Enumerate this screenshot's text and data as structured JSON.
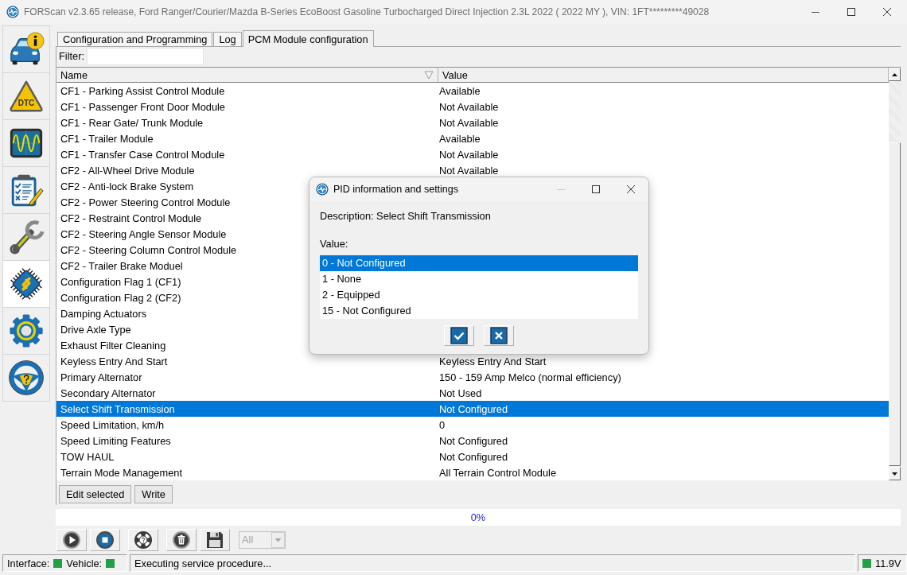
{
  "window": {
    "title": "FORScan v2.3.65 release, Ford Ranger/Courier/Mazda B-Series EcoBoost Gasoline Turbocharged Direct Injection 2.3L 2022 ( 2022 MY ), VIN: 1FT*********49028"
  },
  "sidebar": {
    "items": [
      {
        "kind": "vehicle",
        "selected": false
      },
      {
        "kind": "dtc",
        "label": "DTC",
        "selected": false
      },
      {
        "kind": "oscilloscope",
        "selected": false
      },
      {
        "kind": "checklist",
        "selected": false
      },
      {
        "kind": "service",
        "selected": false
      },
      {
        "kind": "modules",
        "selected": true
      },
      {
        "kind": "settings",
        "selected": false
      },
      {
        "kind": "help",
        "selected": false
      }
    ]
  },
  "tabs": [
    {
      "label": "Configuration and Programming",
      "selected": false
    },
    {
      "label": "Log",
      "selected": false
    },
    {
      "label": "PCM Module configuration",
      "selected": true
    }
  ],
  "filter": {
    "label": "Filter:"
  },
  "table": {
    "columns": [
      {
        "label": "Name",
        "sorted": true
      },
      {
        "label": "Value",
        "sorted": false
      }
    ],
    "rows": [
      {
        "name": "CF1 - Parking Assist Control Module",
        "value": "Available",
        "selected": false
      },
      {
        "name": "CF1 - Passenger Front Door Module",
        "value": "Not Available",
        "selected": false
      },
      {
        "name": "CF1 - Rear Gate/ Trunk Module",
        "value": "Not Available",
        "selected": false
      },
      {
        "name": "CF1 - Trailer Module",
        "value": "Available",
        "selected": false
      },
      {
        "name": "CF1 - Transfer Case Control Module",
        "value": "Not Available",
        "selected": false
      },
      {
        "name": "CF2 - All-Wheel Drive Module",
        "value": "Not Available",
        "selected": false
      },
      {
        "name": "CF2 - Anti-lock Brake System",
        "selected": false
      },
      {
        "name": "CF2 - Power Steering Control Module",
        "selected": false
      },
      {
        "name": "CF2 - Restraint Control Module",
        "selected": false
      },
      {
        "name": "CF2 - Steering Angle Sensor Module",
        "selected": false
      },
      {
        "name": "CF2 - Steering Column Control Module",
        "selected": false
      },
      {
        "name": "CF2 - Trailer Brake Moduel",
        "selected": false
      },
      {
        "name": "Configuration Flag 1 (CF1)",
        "selected": false
      },
      {
        "name": "Configuration Flag 2 (CF2)",
        "selected": false
      },
      {
        "name": "Damping Actuators",
        "selected": false
      },
      {
        "name": "Drive Axle Type",
        "selected": false
      },
      {
        "name": "Exhaust Filter Cleaning",
        "selected": false
      },
      {
        "name": "Keyless Entry And Start",
        "value": "Keyless Entry And Start",
        "selected": false
      },
      {
        "name": "Primary Alternator",
        "value": "150 - 159 Amp Melco (normal efficiency)",
        "selected": false
      },
      {
        "name": "Secondary Alternator",
        "value": "Not Used",
        "selected": false
      },
      {
        "name": "Select Shift Transmission",
        "value": "Not Configured",
        "selected": true
      },
      {
        "name": "Speed Limitation, km/h",
        "value": "0",
        "selected": false
      },
      {
        "name": "Speed Limiting Features",
        "value": "Not Configured",
        "selected": false
      },
      {
        "name": "TOW HAUL",
        "value": "Not Configured",
        "selected": false
      },
      {
        "name": "Terrain Mode Management",
        "value": "All Terrain Control Module",
        "selected": false
      }
    ]
  },
  "actions": [
    {
      "label": "Edit selected"
    },
    {
      "label": "Write"
    }
  ],
  "progress": {
    "level": 0,
    "reading": "0%"
  },
  "toolbar": {
    "dropdown": {
      "value": "All",
      "disabled": true
    }
  },
  "status_bar": {
    "indicators": [
      {
        "label": "Interface:",
        "color": "#22a048"
      },
      {
        "label": "Vehicle:",
        "color": "#22a048"
      }
    ],
    "message": "Executing service procedure...",
    "voltage": {
      "reading": "11.9V",
      "color": "#22a048"
    }
  },
  "dialog": {
    "title": "PID information and settings",
    "minimize_disabled": true,
    "description": "Description: Select Shift Transmission",
    "value_label": "Value:",
    "options": [
      {
        "label": "0 - Not Configured",
        "selected": true
      },
      {
        "label": "1 - None",
        "selected": false
      },
      {
        "label": "2 - Equipped",
        "selected": false
      },
      {
        "label": "15 - Not Configured",
        "selected": false
      }
    ]
  }
}
